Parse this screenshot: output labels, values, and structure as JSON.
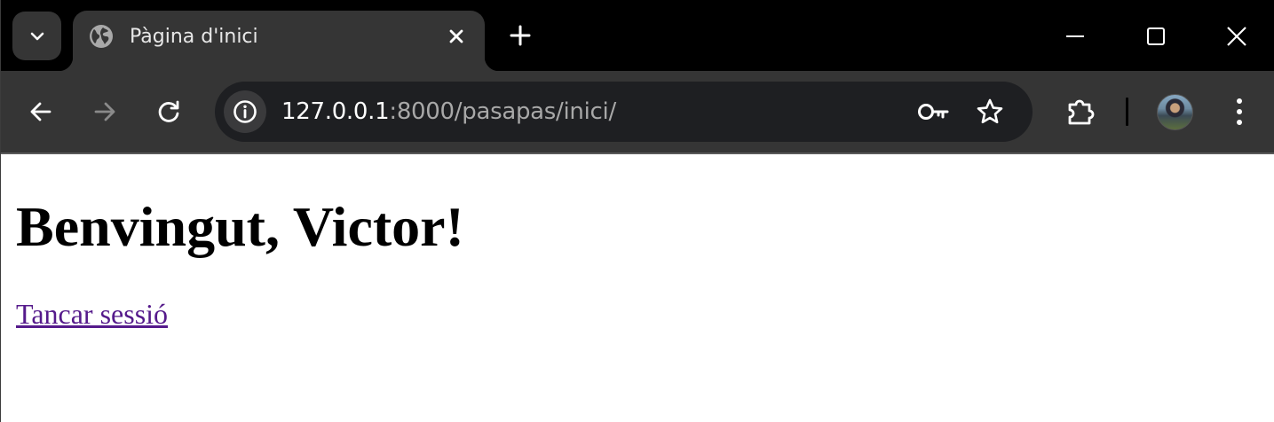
{
  "browser": {
    "tab": {
      "title": "Pàgina d'inici",
      "favicon": "globe-icon"
    },
    "address_bar": {
      "host": "127.0.0.1",
      "rest": ":8000/pasapas/inici/"
    },
    "icons": {
      "tab_search": "chevron-down-icon",
      "close_tab": "close-icon",
      "new_tab": "plus-icon",
      "minimize": "minimize-icon",
      "maximize": "maximize-icon",
      "close_window": "close-icon",
      "back": "back-arrow-icon",
      "forward": "forward-arrow-icon",
      "reload": "reload-icon",
      "site_info": "info-icon",
      "password": "key-icon",
      "bookmark": "star-icon",
      "extensions": "puzzle-icon",
      "profile": "avatar",
      "menu": "kebab-menu-icon"
    },
    "colors": {
      "tabstrip": "#000000",
      "toolbar": "#353535",
      "omnibox": "#1e1f22",
      "visited_link": "#551a8b"
    }
  },
  "page": {
    "heading": "Benvingut, Victor!",
    "logout_link": "Tancar sessió"
  }
}
